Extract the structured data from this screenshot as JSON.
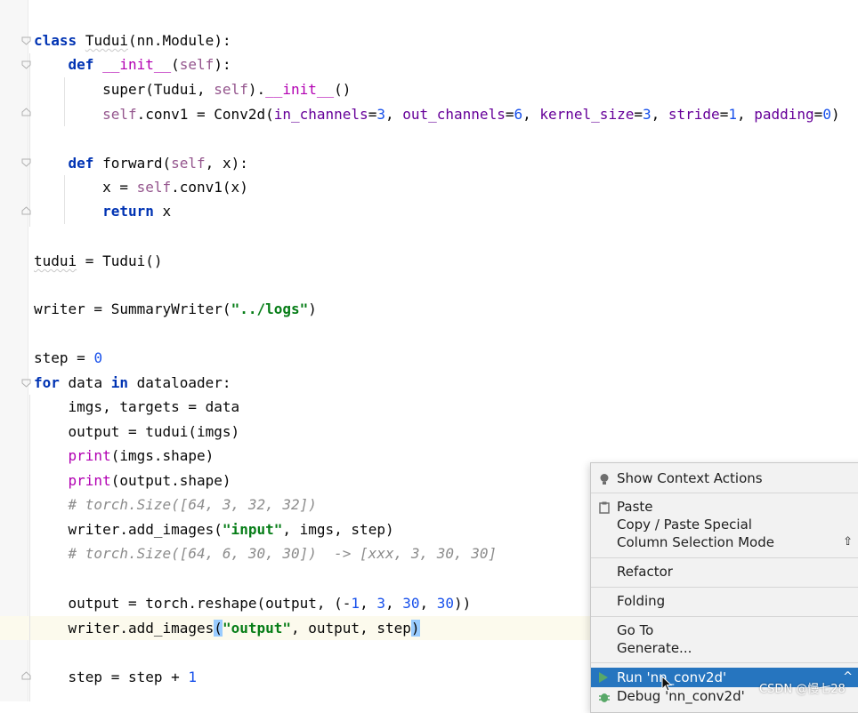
{
  "editor": {
    "lines": [
      {
        "id": "l1",
        "segments": [
          {
            "t": "class",
            "c": "kw"
          },
          {
            "t": " "
          },
          {
            "t": "Tudui",
            "c": "squig"
          },
          {
            "t": "(nn.Module):"
          }
        ]
      },
      {
        "id": "l2",
        "segments": [
          {
            "t": "    "
          },
          {
            "t": "def",
            "c": "kw"
          },
          {
            "t": " "
          },
          {
            "t": "__init__",
            "c": "dunder"
          },
          {
            "t": "("
          },
          {
            "t": "self",
            "c": "self"
          },
          {
            "t": "):"
          }
        ]
      },
      {
        "id": "l3",
        "segments": [
          {
            "t": "        super(Tudui, "
          },
          {
            "t": "self",
            "c": "self"
          },
          {
            "t": ")."
          },
          {
            "t": "__init__",
            "c": "dunder"
          },
          {
            "t": "()"
          }
        ]
      },
      {
        "id": "l4",
        "segments": [
          {
            "t": "        "
          },
          {
            "t": "self",
            "c": "self"
          },
          {
            "t": ".conv1 = Conv2d("
          },
          {
            "t": "in_channels",
            "c": "param"
          },
          {
            "t": "="
          },
          {
            "t": "3",
            "c": "num"
          },
          {
            "t": ", "
          },
          {
            "t": "out_channels",
            "c": "param"
          },
          {
            "t": "="
          },
          {
            "t": "6",
            "c": "num"
          },
          {
            "t": ", "
          },
          {
            "t": "kernel_size",
            "c": "param"
          },
          {
            "t": "="
          },
          {
            "t": "3",
            "c": "num"
          },
          {
            "t": ", "
          },
          {
            "t": "stride",
            "c": "param"
          },
          {
            "t": "="
          },
          {
            "t": "1",
            "c": "num"
          },
          {
            "t": ", "
          },
          {
            "t": "padding",
            "c": "param"
          },
          {
            "t": "="
          },
          {
            "t": "0",
            "c": "num"
          },
          {
            "t": ")"
          }
        ]
      },
      {
        "id": "l5",
        "segments": [
          {
            "t": ""
          }
        ]
      },
      {
        "id": "l6",
        "segments": [
          {
            "t": "    "
          },
          {
            "t": "def",
            "c": "kw"
          },
          {
            "t": " forward("
          },
          {
            "t": "self",
            "c": "self"
          },
          {
            "t": ", x):"
          }
        ]
      },
      {
        "id": "l7",
        "segments": [
          {
            "t": "        x = "
          },
          {
            "t": "self",
            "c": "self"
          },
          {
            "t": ".conv1(x)"
          }
        ]
      },
      {
        "id": "l8",
        "segments": [
          {
            "t": "        "
          },
          {
            "t": "return",
            "c": "kw"
          },
          {
            "t": " x"
          }
        ]
      },
      {
        "id": "l9",
        "segments": [
          {
            "t": ""
          }
        ]
      },
      {
        "id": "l10",
        "segments": [
          {
            "t": "tudui",
            "c": "squig"
          },
          {
            "t": " = Tudui()"
          }
        ]
      },
      {
        "id": "l11",
        "segments": [
          {
            "t": ""
          }
        ]
      },
      {
        "id": "l12",
        "segments": [
          {
            "t": "writer = SummaryWriter("
          },
          {
            "t": "\"../logs\"",
            "c": "str"
          },
          {
            "t": ")"
          }
        ]
      },
      {
        "id": "l13",
        "segments": [
          {
            "t": ""
          }
        ]
      },
      {
        "id": "l14",
        "segments": [
          {
            "t": "step = "
          },
          {
            "t": "0",
            "c": "num"
          }
        ]
      },
      {
        "id": "l15",
        "segments": [
          {
            "t": "for",
            "c": "kw"
          },
          {
            "t": " data "
          },
          {
            "t": "in",
            "c": "kw"
          },
          {
            "t": " dataloader:"
          }
        ]
      },
      {
        "id": "l16",
        "segments": [
          {
            "t": "    imgs, targets = data"
          }
        ]
      },
      {
        "id": "l17",
        "segments": [
          {
            "t": "    output = tudui(imgs)"
          }
        ]
      },
      {
        "id": "l18",
        "segments": [
          {
            "t": "    "
          },
          {
            "t": "print",
            "c": "dunder"
          },
          {
            "t": "(imgs.shape)"
          }
        ]
      },
      {
        "id": "l19",
        "segments": [
          {
            "t": "    "
          },
          {
            "t": "print",
            "c": "dunder"
          },
          {
            "t": "(output.shape)"
          }
        ]
      },
      {
        "id": "l20",
        "segments": [
          {
            "t": "    "
          },
          {
            "t": "# torch.Size([64, 3, 32, 32])",
            "c": "cmt"
          }
        ]
      },
      {
        "id": "l21",
        "segments": [
          {
            "t": "    writer.add_images("
          },
          {
            "t": "\"input\"",
            "c": "str"
          },
          {
            "t": ", imgs, step)"
          }
        ]
      },
      {
        "id": "l22",
        "segments": [
          {
            "t": "    "
          },
          {
            "t": "# torch.Size([64, 6, 30, 30])  -> [xxx, 3, 30, 30]",
            "c": "cmt"
          }
        ]
      },
      {
        "id": "l23",
        "segments": [
          {
            "t": ""
          }
        ]
      },
      {
        "id": "l24",
        "segments": [
          {
            "t": "    output = torch.reshape(output, (-"
          },
          {
            "t": "1",
            "c": "num"
          },
          {
            "t": ", "
          },
          {
            "t": "3",
            "c": "num"
          },
          {
            "t": ", "
          },
          {
            "t": "30",
            "c": "num"
          },
          {
            "t": ", "
          },
          {
            "t": "30",
            "c": "num"
          },
          {
            "t": "))"
          }
        ]
      },
      {
        "id": "l25",
        "segments": [
          {
            "t": "    writer.add_images"
          },
          {
            "t": "(",
            "c": "brace"
          },
          {
            "t": "\"output\"",
            "c": "str"
          },
          {
            "t": ", output, step"
          },
          {
            "t": ")",
            "c": "brace"
          }
        ]
      },
      {
        "id": "l26",
        "segments": [
          {
            "t": ""
          }
        ]
      },
      {
        "id": "l27",
        "segments": [
          {
            "t": "    step = step + "
          },
          {
            "t": "1",
            "c": "num"
          }
        ]
      }
    ]
  },
  "context_menu": {
    "items": {
      "show_context_actions": "Show Context Actions",
      "paste": "Paste",
      "copy_paste_special": "Copy / Paste Special",
      "column_selection_mode": "Column Selection Mode",
      "refactor": "Refactor",
      "folding": "Folding",
      "go_to": "Go To",
      "generate": "Generate...",
      "run": "Run 'nn_conv2d'",
      "debug": "Debug 'nn_conv2d'"
    },
    "selected": "run",
    "accent_color": "#2675bf",
    "icons": [
      "lightbulb-icon",
      "clipboard-icon",
      "run-icon",
      "debug-icon"
    ]
  },
  "watermark": "CSDN @慢七28"
}
